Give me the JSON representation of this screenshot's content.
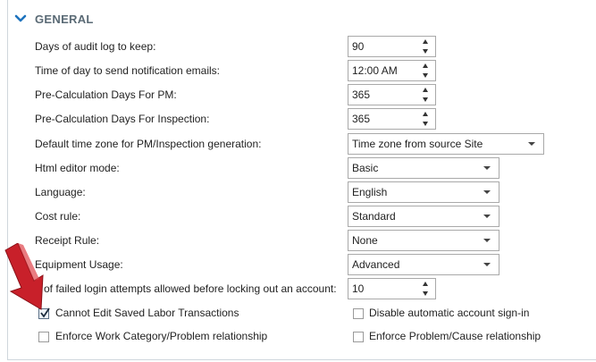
{
  "section": {
    "title": "GENERAL",
    "icon": "chevron-down-icon"
  },
  "fields": {
    "audit_log_days": {
      "label": "Days of audit log to keep:",
      "value": "90"
    },
    "notification_time": {
      "label": "Time of day to send notification emails:",
      "value": "12:00 AM"
    },
    "precalc_pm": {
      "label": "Pre-Calculation Days For PM:",
      "value": "365"
    },
    "precalc_inspection": {
      "label": "Pre-Calculation Days For Inspection:",
      "value": "365"
    },
    "time_zone": {
      "label": "Default time zone for PM/Inspection generation:",
      "value": "Time zone from source Site"
    },
    "html_editor": {
      "label": "Html editor mode:",
      "value": "Basic"
    },
    "language": {
      "label": "Language:",
      "value": "English"
    },
    "cost_rule": {
      "label": "Cost rule:",
      "value": "Standard"
    },
    "receipt_rule": {
      "label": "Receipt Rule:",
      "value": "None"
    },
    "equipment_usage": {
      "label": "Equipment Usage:",
      "value": "Advanced"
    },
    "failed_logins": {
      "label": "# of failed login attempts allowed before locking out an account:",
      "value": "10"
    }
  },
  "checkboxes": {
    "cannot_edit_labor": {
      "label": "Cannot Edit Saved Labor Transactions",
      "checked": true
    },
    "disable_auto_signin": {
      "label": "Disable automatic account sign-in",
      "checked": false
    },
    "enforce_work_category": {
      "label": "Enforce Work Category/Problem relationship",
      "checked": false
    },
    "enforce_problem_cause": {
      "label": "Enforce Problem/Cause relationship",
      "checked": false
    }
  },
  "colors": {
    "accent": "#1e73be",
    "pointer": "#c8202a",
    "header_text": "#5a6a75"
  }
}
